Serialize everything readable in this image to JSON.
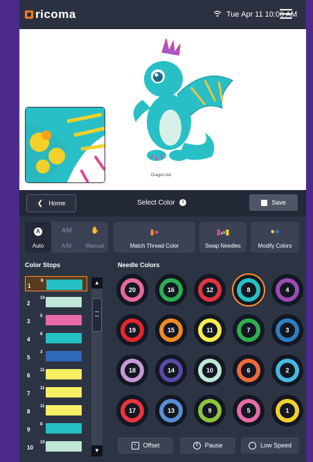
{
  "header": {
    "brand": "ricoma",
    "datetime": "Tue Apr 11  10:00 AM"
  },
  "preview": {
    "filename": "Dragon.dst"
  },
  "actionbar": {
    "home_label": "Home",
    "title": "Select Color",
    "save_label": "Save"
  },
  "modes": [
    {
      "label": "Auto",
      "active": true
    },
    {
      "label": "A/M",
      "active": false
    },
    {
      "label": "Manual",
      "active": false
    }
  ],
  "tools": {
    "match": "Match Thread Color",
    "swap": "Swap Needles",
    "modify": "Modify Colors"
  },
  "sections": {
    "color_stops": "Color Stops",
    "needle_colors": "Needle Colors"
  },
  "color_stops": [
    {
      "index": "1",
      "needle": "8",
      "color": "#25c1c4",
      "selected": true
    },
    {
      "index": "2",
      "needle": "10",
      "color": "#bfe6d6"
    },
    {
      "index": "3",
      "needle": "5",
      "color": "#e96aa8"
    },
    {
      "index": "4",
      "needle": "8",
      "color": "#25c1c4"
    },
    {
      "index": "5",
      "needle": "3",
      "color": "#2f68b8"
    },
    {
      "index": "6",
      "needle": "11",
      "color": "#f7ef62"
    },
    {
      "index": "7",
      "needle": "11",
      "color": "#f7ef62"
    },
    {
      "index": "8",
      "needle": "11",
      "color": "#f7ef62"
    },
    {
      "index": "9",
      "needle": "8",
      "color": "#25c1c4"
    },
    {
      "index": "10",
      "needle": "10",
      "color": "#bfe6d6"
    }
  ],
  "needles": [
    {
      "num": "20",
      "color": "#e86a9d"
    },
    {
      "num": "16",
      "color": "#2fae4f"
    },
    {
      "num": "12",
      "color": "#e33340"
    },
    {
      "num": "8",
      "color": "#25c1c4",
      "selected": true
    },
    {
      "num": "4",
      "color": "#9b4bb3"
    },
    {
      "num": "19",
      "color": "#e5262f"
    },
    {
      "num": "15",
      "color": "#f08a22"
    },
    {
      "num": "11",
      "color": "#f6ec4c"
    },
    {
      "num": "7",
      "color": "#2fae4f"
    },
    {
      "num": "3",
      "color": "#2f7ec0"
    },
    {
      "num": "18",
      "color": "#c79ad3"
    },
    {
      "num": "14",
      "color": "#5a4aa7"
    },
    {
      "num": "10",
      "color": "#bfe6d6"
    },
    {
      "num": "6",
      "color": "#ef6a3a"
    },
    {
      "num": "2",
      "color": "#4ab6e2"
    },
    {
      "num": "17",
      "color": "#e7353d"
    },
    {
      "num": "13",
      "color": "#5a8ed1"
    },
    {
      "num": "9",
      "color": "#8fc43a"
    },
    {
      "num": "5",
      "color": "#e96aa8"
    },
    {
      "num": "1",
      "color": "#f3d12a"
    }
  ],
  "bottom": {
    "offset": "Offset",
    "pause": "Pause",
    "low_speed": "Low Speed"
  }
}
